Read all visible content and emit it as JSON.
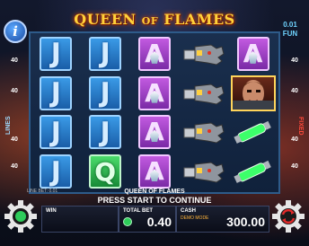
{
  "game": {
    "title_main": "QUEEN",
    "title_of": "OF",
    "title_end": "FLAMES",
    "coin_value": "0.01",
    "coin_currency": "FUN"
  },
  "sidebar": {
    "lines_value": "40",
    "lines_label": "LINES",
    "fixed_label": "FIXED"
  },
  "reels": [
    [
      "J",
      "J",
      "A",
      "gauntlet",
      "A"
    ],
    [
      "J",
      "J",
      "A",
      "gauntlet",
      "villain"
    ],
    [
      "J",
      "J",
      "A",
      "gauntlet",
      "vial"
    ],
    [
      "J",
      "Q",
      "A",
      "gauntlet",
      "vial"
    ]
  ],
  "footer": {
    "line_bet": "LINE BET: 0.01",
    "game_name": "QUEEN OF FLAMES",
    "press_start": "PRESS START TO CONTINUE",
    "win_label": "WIN",
    "total_bet_label": "TOTAL BET",
    "total_bet_value": "0.40",
    "cash_label": "CASH",
    "demo_label": "DEMO MODE",
    "cash_value": "300.00"
  },
  "colors": {
    "accent_blue": "#6fd4ff",
    "title_gold": "#ffd23a",
    "fixed_red": "#ff4a3a",
    "start_green": "#2ecc5a",
    "autoplay_red": "#e02a2a"
  }
}
